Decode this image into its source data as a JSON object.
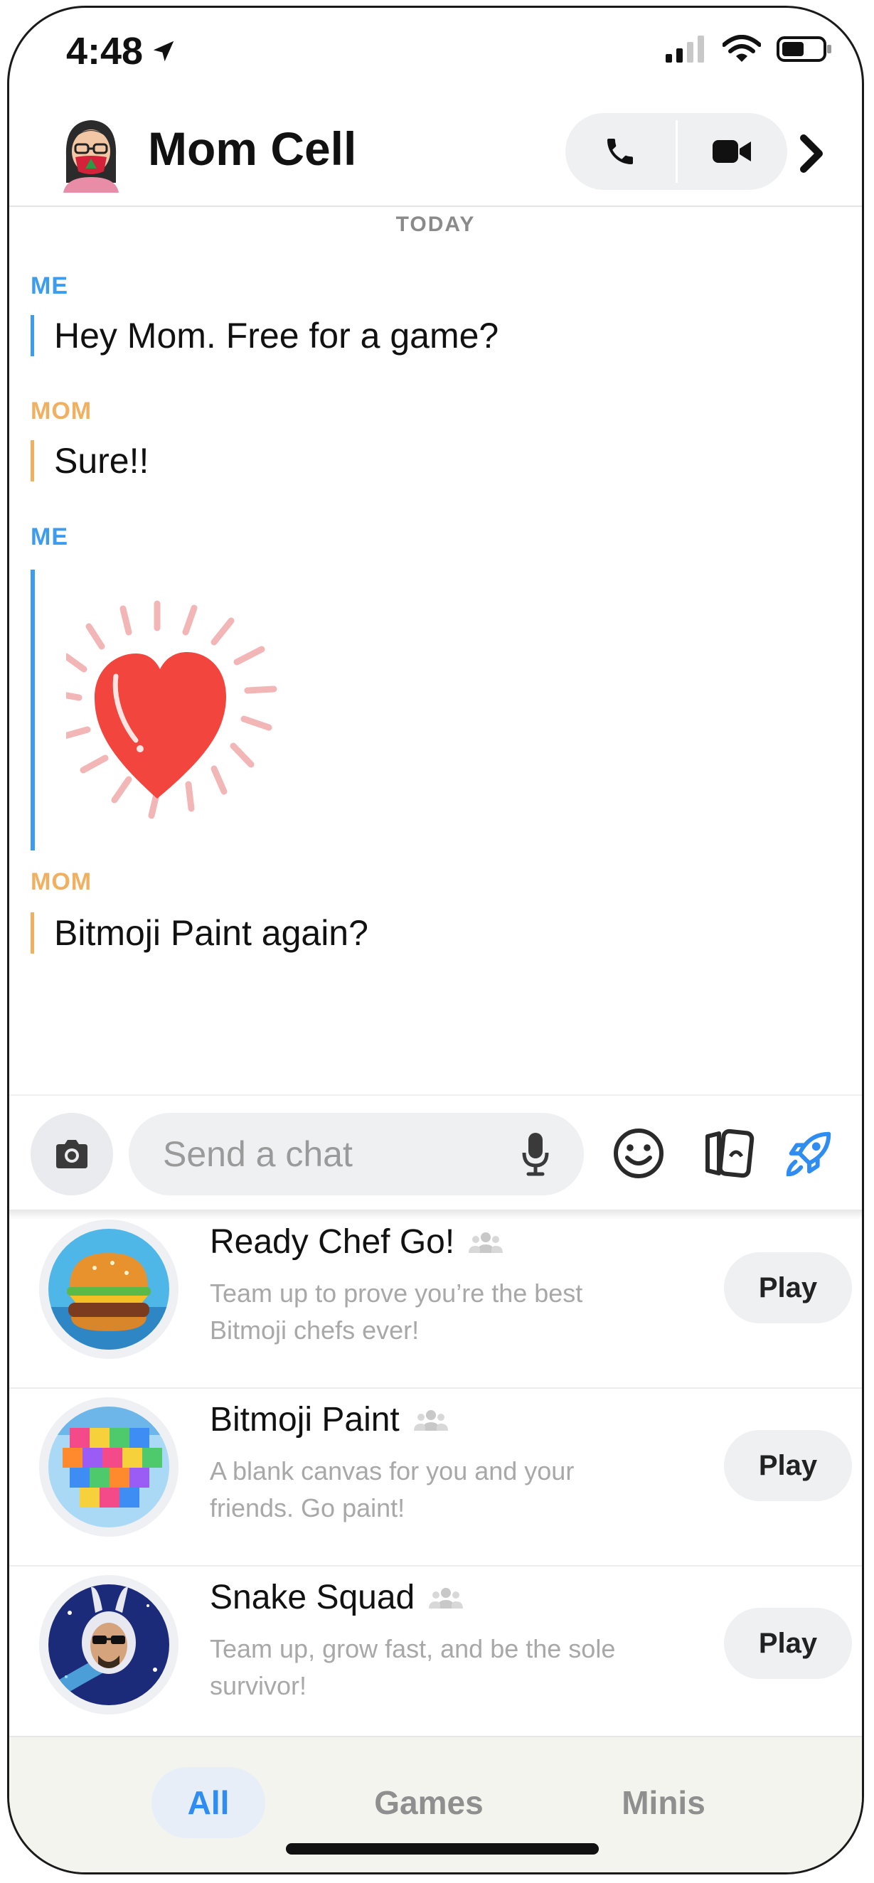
{
  "status_bar": {
    "time": "4:48",
    "location_icon": "location-arrow-icon",
    "signal_icon": "signal-icon",
    "wifi_icon": "wifi-icon",
    "battery_icon": "battery-icon"
  },
  "header": {
    "title": "Mom Cell",
    "avatar_icon": "bitmoji-avatar-icon",
    "voice_call_icon": "phone-icon",
    "video_call_icon": "video-camera-icon",
    "chevron_icon": "chevron-right-icon"
  },
  "chat": {
    "date_label": "TODAY",
    "messages": [
      {
        "sender": "ME",
        "text": "Hey Mom. Free for a game?"
      },
      {
        "sender": "MOM",
        "text": "Sure!!"
      },
      {
        "sender": "ME",
        "sticker": "heart-sticker-icon"
      },
      {
        "sender": "MOM",
        "text": "Bitmoji Paint again?"
      }
    ]
  },
  "composer": {
    "placeholder": "Send a chat",
    "camera_icon": "camera-icon",
    "mic_icon": "microphone-icon",
    "emoji_icon": "smiley-icon",
    "cards_icon": "cards-icon",
    "games_icon": "rocket-icon"
  },
  "games": [
    {
      "name": "Ready Chef Go!",
      "description": "Team up to prove you’re the best Bitmoji chefs ever!",
      "play_label": "Play",
      "icon": "burger-game-icon"
    },
    {
      "name": "Bitmoji Paint",
      "description": "A blank canvas for you and your friends. Go paint!",
      "play_label": "Play",
      "icon": "paint-blocks-game-icon"
    },
    {
      "name": "Snake Squad",
      "description": "Team up, grow fast, and be the sole survivor!",
      "play_label": "Play",
      "icon": "snake-bunny-game-icon"
    }
  ],
  "tabs": [
    {
      "label": "All",
      "active": true
    },
    {
      "label": "Games",
      "active": false
    },
    {
      "label": "Minis",
      "active": false
    }
  ],
  "colors": {
    "me": "#3c9cf0",
    "mom": "#f0b060",
    "accent": "#2f8cf0"
  }
}
